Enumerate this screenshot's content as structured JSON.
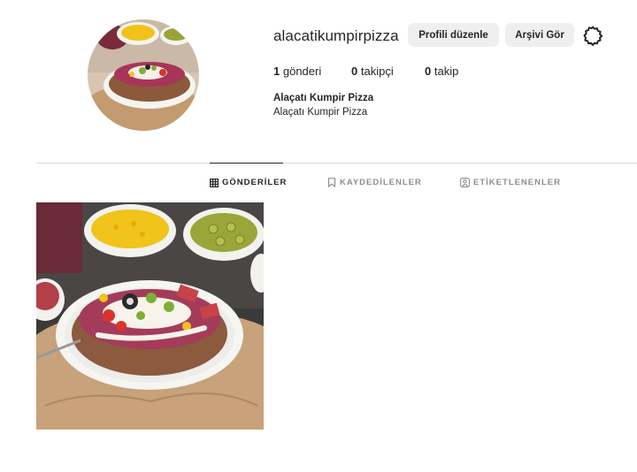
{
  "profile": {
    "username": "alacatikumpirpizza",
    "edit_button": "Profili düzenle",
    "archive_button": "Arşivi Gör",
    "stats": {
      "posts_count": "1",
      "posts_label": "gönderi",
      "followers_count": "0",
      "followers_label": "takipçi",
      "following_count": "0",
      "following_label": "takip"
    },
    "full_name": "Alaçatı Kumpir Pizza",
    "bio": "Alaçatı Kumpir Pizza"
  },
  "tabs": [
    {
      "label": "GÖNDERİLER",
      "icon": "grid-icon",
      "active": true
    },
    {
      "label": "KAYDEDİLENLER",
      "icon": "bookmark-icon",
      "active": false
    },
    {
      "label": "ETİKETLENENLER",
      "icon": "tag-user-icon",
      "active": false
    }
  ],
  "colors": {
    "text": "#262626",
    "muted": "#8e8e8e",
    "button_bg": "#efefef",
    "divider": "#dbdbdb"
  }
}
